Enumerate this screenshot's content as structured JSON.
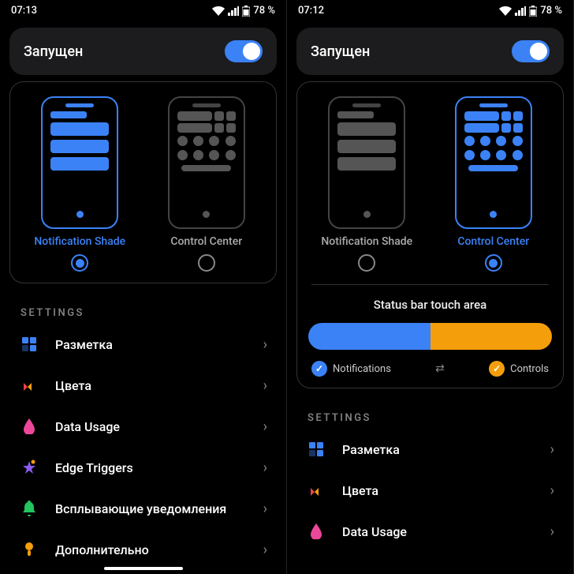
{
  "left": {
    "status": {
      "time": "07:13",
      "battery": "78 %"
    },
    "running_label": "Запущен",
    "options": [
      {
        "label": "Notification Shade",
        "selected": true
      },
      {
        "label": "Control Center",
        "selected": false
      }
    ],
    "settings_header": "SETTINGS",
    "settings": [
      {
        "icon": "layout",
        "label": "Разметка"
      },
      {
        "icon": "colors",
        "label": "Цвета"
      },
      {
        "icon": "data",
        "label": "Data Usage"
      },
      {
        "icon": "edge",
        "label": "Edge Triggers"
      },
      {
        "icon": "popup",
        "label": "Всплывающие уведомления"
      },
      {
        "icon": "extra",
        "label": "Дополнительно"
      }
    ]
  },
  "right": {
    "status": {
      "time": "07:12",
      "battery": "78 %"
    },
    "running_label": "Запущен",
    "options": [
      {
        "label": "Notification Shade",
        "selected": false
      },
      {
        "label": "Control Center",
        "selected": true
      }
    ],
    "touch_area": {
      "title": "Status bar touch area",
      "left_label": "Notifications",
      "right_label": "Controls"
    },
    "settings_header": "SETTINGS",
    "settings": [
      {
        "icon": "layout",
        "label": "Разметка"
      },
      {
        "icon": "colors",
        "label": "Цвета"
      },
      {
        "icon": "data",
        "label": "Data Usage"
      }
    ]
  }
}
